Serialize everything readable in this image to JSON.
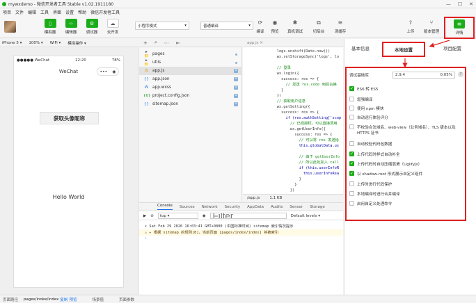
{
  "titlebar": {
    "title": "mywxdemo - 微信开发者工具 Stable v1.02.1911180"
  },
  "menubar": {
    "items": [
      "项目",
      "文件",
      "编辑",
      "工具",
      "界面",
      "设置",
      "帮助",
      "微信开发者工具"
    ]
  },
  "toolbar": {
    "simulator": "模拟器",
    "editor": "编辑器",
    "debugger": "调试器",
    "cloud": "云开发",
    "mode": "小程序模式",
    "compile_mode": "普通编译",
    "compile": "编译",
    "preview": "预览",
    "remote_debug": "真机调试",
    "cut_bg": "切后台",
    "clear_cache": "清缓存",
    "upload": "上传",
    "version": "版本管理",
    "detail": "详情"
  },
  "simbar": {
    "device": "iPhone 5",
    "zoom": "100%",
    "network": "WiFi",
    "action": "模拟操作"
  },
  "phone": {
    "carrier": "●●●●● WeChat",
    "time": "12:20",
    "battery": "78%",
    "nav_title": "WeChat",
    "button": "获取头像昵称",
    "hello": "Hello World"
  },
  "tree": {
    "items": [
      {
        "label": "pages",
        "icon": "▸ 📁",
        "mark": "dot"
      },
      {
        "label": "utils",
        "icon": "▸ 📁",
        "mark": "dot"
      },
      {
        "label": "app.js",
        "icon": "JS",
        "mark": "U"
      },
      {
        "label": "app.json",
        "icon": "{}",
        "mark": "U"
      },
      {
        "label": "app.wxss",
        "icon": "W",
        "mark": "U"
      },
      {
        "label": "project.config.json",
        "icon": "{0}",
        "mark": "U"
      },
      {
        "label": "sitemap.json",
        "icon": "{}",
        "mark": "U"
      }
    ]
  },
  "editor": {
    "tab": "app.js",
    "lines": [
      "    logs.unshift(Date.now())",
      "    wx.setStorageSync('logs', lo",
      "",
      "    // 登录",
      "    wx.login({",
      "      success: res => {",
      "        // 发送 res.code 到后台换",
      "      }",
      "    })",
      "    // 获取用户信息",
      "    wx.getSetting({",
      "      success: res => {",
      "        if (res.authSetting['scop",
      "          // 已经授权，可以直接调用",
      "          wx.getUserInfo({",
      "            success: res => {",
      "              // 可以将 res 发送给",
      "              this.globalData.us",
      "",
      "              // 由于 getUserInfo",
      "              // 所以此处加入 call",
      "              if (this.userInfoR",
      "                this.userInfoRea",
      "              }",
      "            }",
      "          })"
    ],
    "path": "/app.js",
    "size": "1.1 KB"
  },
  "console": {
    "tabs": [
      "Console",
      "Sources",
      "Network",
      "Security",
      "AppData",
      "Audits",
      "Sensor",
      "Storage"
    ],
    "context": "top",
    "filter_placeholder": "Filter",
    "levels": "Default levels ▾",
    "log1": "▾ Sat Feb 29 2020 16:03:41 GMT+0800 (中国标准时间) sitemap 索引情况提示",
    "log2": "⚠ ▸ 根据 sitemap 的规则[0]，当前页面 [pages/index/index] 将被索引",
    "prompt": "›"
  },
  "bottombar": {
    "path_label": "页面路径",
    "path": "pages/index/index",
    "copy": "复制",
    "preview": "预览",
    "scene": "场景值",
    "params": "页面参数"
  },
  "details": {
    "tab_basic": "基本信息",
    "tab_local": "本地设置",
    "tab_project": "项目配置",
    "lib_label": "调试基础库",
    "lib_value": "2.9.4",
    "lib_percent": "0.05%",
    "settings": [
      {
        "label": "ES6 转 ES5",
        "on": true
      },
      {
        "label": "增强编译",
        "on": false
      },
      {
        "label": "使用 npm 模块",
        "on": false
      },
      {
        "label": "自动运行体验评分",
        "on": false
      },
      {
        "label": "不校验合法域名、web-view（业务域名）、TLS 版本以及 HTTPS 证书",
        "on": false
      },
      {
        "label": "自动校验代码包数据",
        "on": false
      },
      {
        "label": "上传代码时样式自动补全",
        "on": true
      },
      {
        "label": "上传代码时自动压缩混淆（UglifyJs）",
        "on": true
      },
      {
        "label": "以 shadow-root 形式展示自定义组件",
        "on": true
      },
      {
        "label": "上传时进行代码保护",
        "on": false
      },
      {
        "label": "本地编译时进行合并编译",
        "on": false
      },
      {
        "label": "启用自定义处理命令",
        "on": false
      }
    ]
  }
}
